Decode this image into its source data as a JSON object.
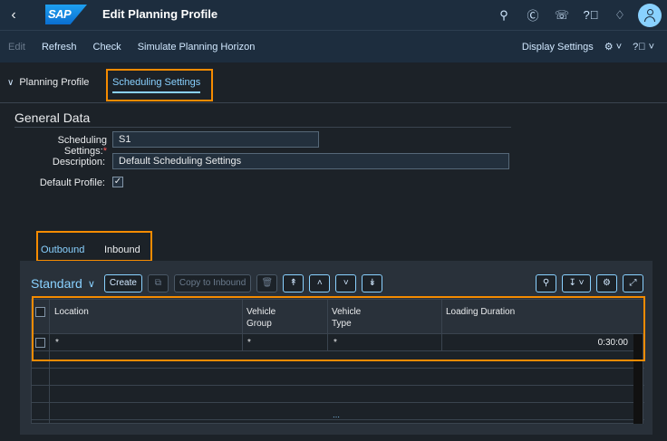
{
  "shell": {
    "logo_text": "SAP",
    "title": "Edit Planning Profile",
    "icons": [
      "search-icon",
      "copilot-icon",
      "support-icon",
      "help-icon",
      "notification-icon",
      "user-avatar-icon"
    ]
  },
  "toolbar": {
    "edit": "Edit",
    "refresh": "Refresh",
    "check": "Check",
    "simulate": "Simulate Planning Horizon",
    "display_settings": "Display Settings"
  },
  "tabs": {
    "planning_profile": "Planning Profile",
    "scheduling_settings": "Scheduling Settings"
  },
  "general": {
    "title": "General Data",
    "scheduling_label": "Scheduling Settings:",
    "scheduling_value": "S1",
    "description_label": "Description:",
    "description_value": "Default Scheduling Settings",
    "default_profile_label": "Default Profile:",
    "default_profile_checked": "✓"
  },
  "subtabs": {
    "outbound": "Outbound",
    "inbound": "Inbound"
  },
  "table": {
    "variant": "Standard",
    "buttons": {
      "create": "Create",
      "copy_to_inbound": "Copy to Inbound"
    },
    "columns": [
      "Location",
      "Vehicle Group",
      "Vehicle Type",
      "Loading Duration"
    ],
    "columns_split": [
      [
        "Location"
      ],
      [
        "Vehicle",
        "Group"
      ],
      [
        "Vehicle",
        "Type"
      ],
      [
        "Loading Duration"
      ]
    ],
    "rows": [
      {
        "location": "*",
        "vehicle_group": "*",
        "vehicle_type": "*",
        "loading_duration": "0:30:00"
      }
    ]
  },
  "colors": {
    "shell_bg": "#1d2d3e",
    "page_bg": "#1c2228",
    "accent": "#89d1ff",
    "highlight": "#f58b00"
  }
}
